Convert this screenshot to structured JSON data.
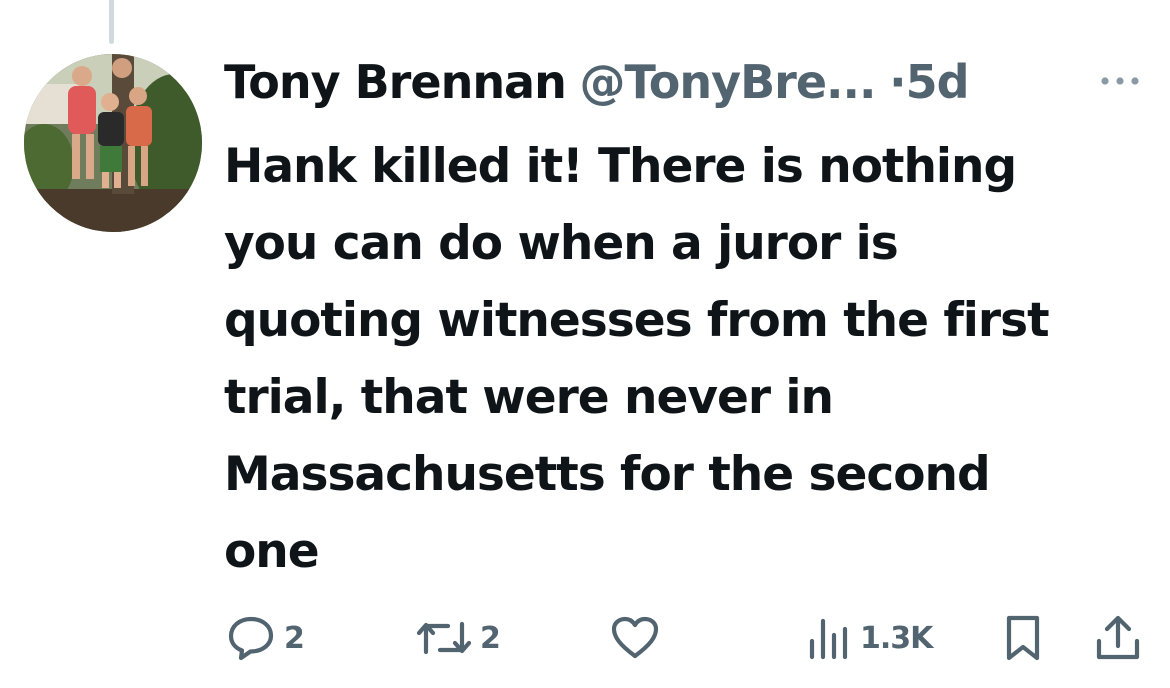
{
  "tweet": {
    "author_name": "Tony Brennan",
    "author_handle": "@TonyBre...",
    "separator": "·",
    "timestamp": "5d",
    "text_lines": [
      "Hank killed it! There is nothing",
      "you can do when a juror is",
      "quoting witnesses from the first",
      "trial, that were never in",
      "Massachusetts for the second",
      "one"
    ],
    "avatar_icon": "profile-photo-family"
  },
  "actions": {
    "replies": "2",
    "reposts": "2",
    "likes": "",
    "views": "1.3K"
  },
  "icons": {
    "more": "more-horizontal-icon",
    "reply": "reply-bubble-icon",
    "repost": "repost-arrows-icon",
    "like": "heart-icon",
    "views": "bar-chart-icon",
    "bookmark": "bookmark-icon",
    "share": "share-upload-icon"
  },
  "colors": {
    "text_primary": "#0f1419",
    "text_secondary": "#536471",
    "thread_line": "#cfd9de"
  }
}
